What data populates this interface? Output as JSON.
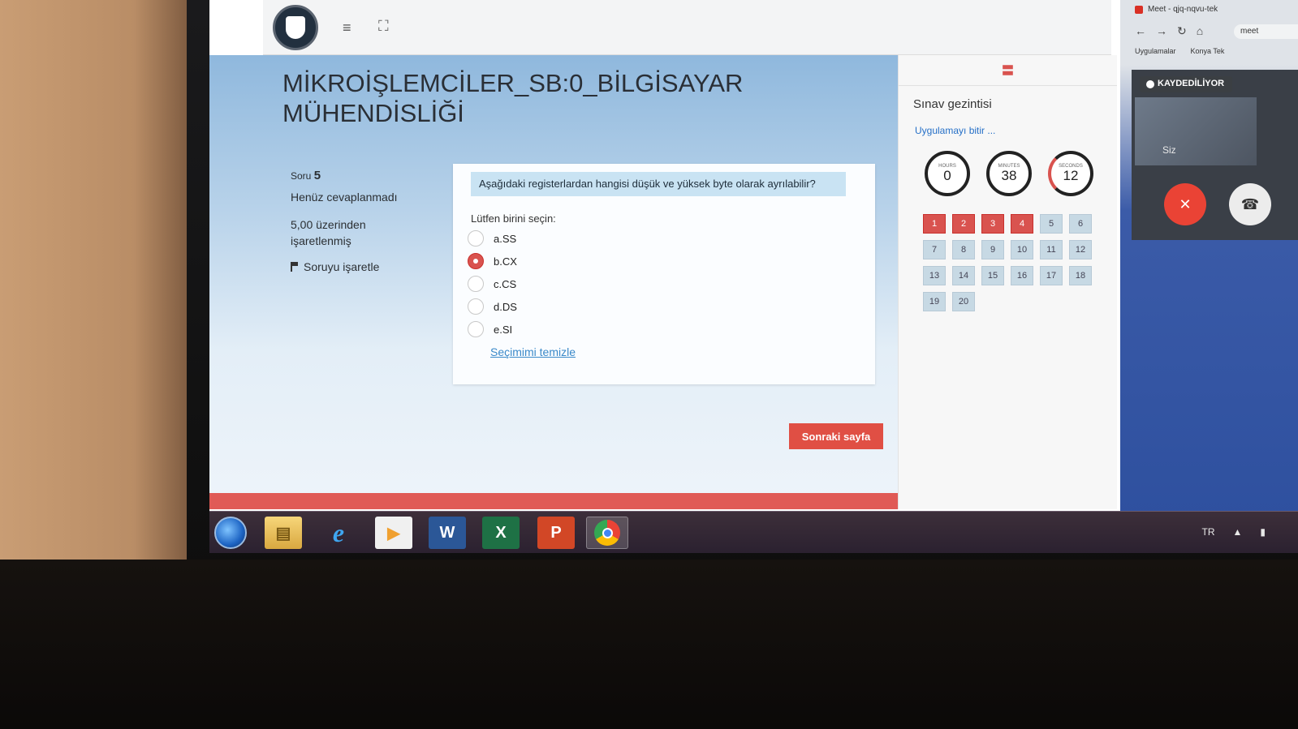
{
  "course": {
    "title_line1": "MİKROİŞLEMCİLER_SB:0_BİLGİSAYAR",
    "title_line2": "MÜHENDİSLİĞİ"
  },
  "question_info": {
    "label": "Soru",
    "number": "5",
    "state": "Henüz cevaplanmadı",
    "grade_line1": "5,00 üzerinden",
    "grade_line2": "işaretlenmiş",
    "flag_label": "Soruyu işaretle"
  },
  "question": {
    "text": "Aşağıdaki registerlardan hangisi düşük ve yüksek byte olarak ayrılabilir?",
    "prompt": "Lütfen birini seçin:",
    "answers": [
      {
        "label": "a.SS",
        "checked": false
      },
      {
        "label": "b.CX",
        "checked": true
      },
      {
        "label": "c.CS",
        "checked": false
      },
      {
        "label": "d.DS",
        "checked": false
      },
      {
        "label": "e.SI",
        "checked": false
      }
    ],
    "clear_label": "Seçimimi temizle"
  },
  "next_button": "Sonraki sayfa",
  "navigation": {
    "title": "Sınav gezintisi",
    "finish_link": "Uygulamayı bitir ...",
    "timer": {
      "hours_label": "HOURS",
      "hours": "0",
      "minutes_label": "MINUTES",
      "minutes": "38",
      "seconds_label": "SECONDS",
      "seconds": "12"
    },
    "questions": [
      "1",
      "2",
      "3",
      "4",
      "5",
      "6",
      "7",
      "8",
      "9",
      "10",
      "11",
      "12",
      "13",
      "14",
      "15",
      "16",
      "17",
      "18",
      "19",
      "20"
    ],
    "answered": [
      "1",
      "2",
      "3",
      "4"
    ]
  },
  "meet": {
    "tab_title": "Meet - qjq-nqvu-tek",
    "address": "meet",
    "bookmark_1": "Uygulamalar",
    "bookmark_2": "Konya Tek",
    "recording_badge": "KAYDEDİLİYOR",
    "self_label": "Siz"
  },
  "taskbar": {
    "language": "TR",
    "apps": [
      "explorer",
      "internet-explorer",
      "media-player",
      "word",
      "excel",
      "powerpoint",
      "chrome"
    ],
    "word_letter": "W",
    "excel_letter": "X",
    "ppt_letter": "P"
  },
  "colors": {
    "accent_red": "#e04f44",
    "answered_red": "#d9534f",
    "link_blue": "#3a89c9",
    "question_bg": "#c9e3f3"
  }
}
